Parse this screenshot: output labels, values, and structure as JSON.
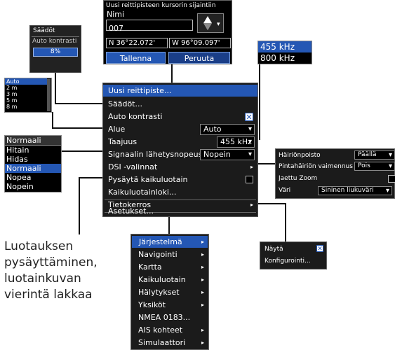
{
  "waypoint_dialog": {
    "title": "Uusi reittipisteen kursorin sijaintiin",
    "name_label": "Nimi",
    "name_value": "007",
    "lat": "N  36°22.072'",
    "lon": "W  96°09.097'",
    "save_label": "Tallenna",
    "cancel_label": "Peruuta"
  },
  "settings_box": {
    "title": "Säädöt",
    "label": "Auto kontrasti",
    "value": "8%"
  },
  "frequency_list": [
    "455 kHz",
    "800 kHz"
  ],
  "range_list": [
    "Auto",
    "2 m",
    "3 m",
    "5 m",
    "8 m"
  ],
  "ping_speed_list": [
    "Normaali",
    "Hitain",
    "Hidas",
    "Normaali",
    "Nopea",
    "Nopein"
  ],
  "main_menu": {
    "items": [
      {
        "label": "Uusi reittipiste..."
      },
      {
        "label": "Säädöt..."
      },
      {
        "label": "Auto kontrasti"
      },
      {
        "label": "Alue",
        "value": "Auto"
      },
      {
        "label": "Taajuus",
        "value": "455 kHz"
      },
      {
        "label": "Signaalin lähetysnopeus",
        "value": "Nopein"
      },
      {
        "label": "DSI -valinnat"
      },
      {
        "label": "Pysäytä kaikuluotain"
      },
      {
        "label": "Kaikuluotainloki..."
      },
      {
        "label": "Tietokerros"
      },
      {
        "label": "Asetukset..."
      }
    ]
  },
  "dsi_options": {
    "items": [
      {
        "label": "Häiriönpoisto",
        "value": "Päällä"
      },
      {
        "label": "Pintahäiriön vaimennus",
        "value": "Pois"
      },
      {
        "label": "Jaettu Zoom",
        "value": ""
      },
      {
        "label": "Väri",
        "value": "Sininen liukuväri"
      }
    ]
  },
  "overlay_menu": {
    "items": [
      {
        "label": "Näytä"
      },
      {
        "label": "Konfigurointi..."
      }
    ]
  },
  "settings_submenu": {
    "items": [
      "Järjestelmä",
      "Navigointi",
      "Kartta",
      "Kaikuluotain",
      "Hälytykset",
      "Yksiköt",
      "NMEA 0183...",
      "AIS kohteet",
      "Simulaattori"
    ]
  },
  "caption": [
    "Luotauksen",
    "pysäyttäminen,",
    "luotainkuvan",
    "vierintä lakkaa"
  ],
  "colors": {
    "highlight": "#2457b4",
    "panel": "#1d1d1d"
  }
}
